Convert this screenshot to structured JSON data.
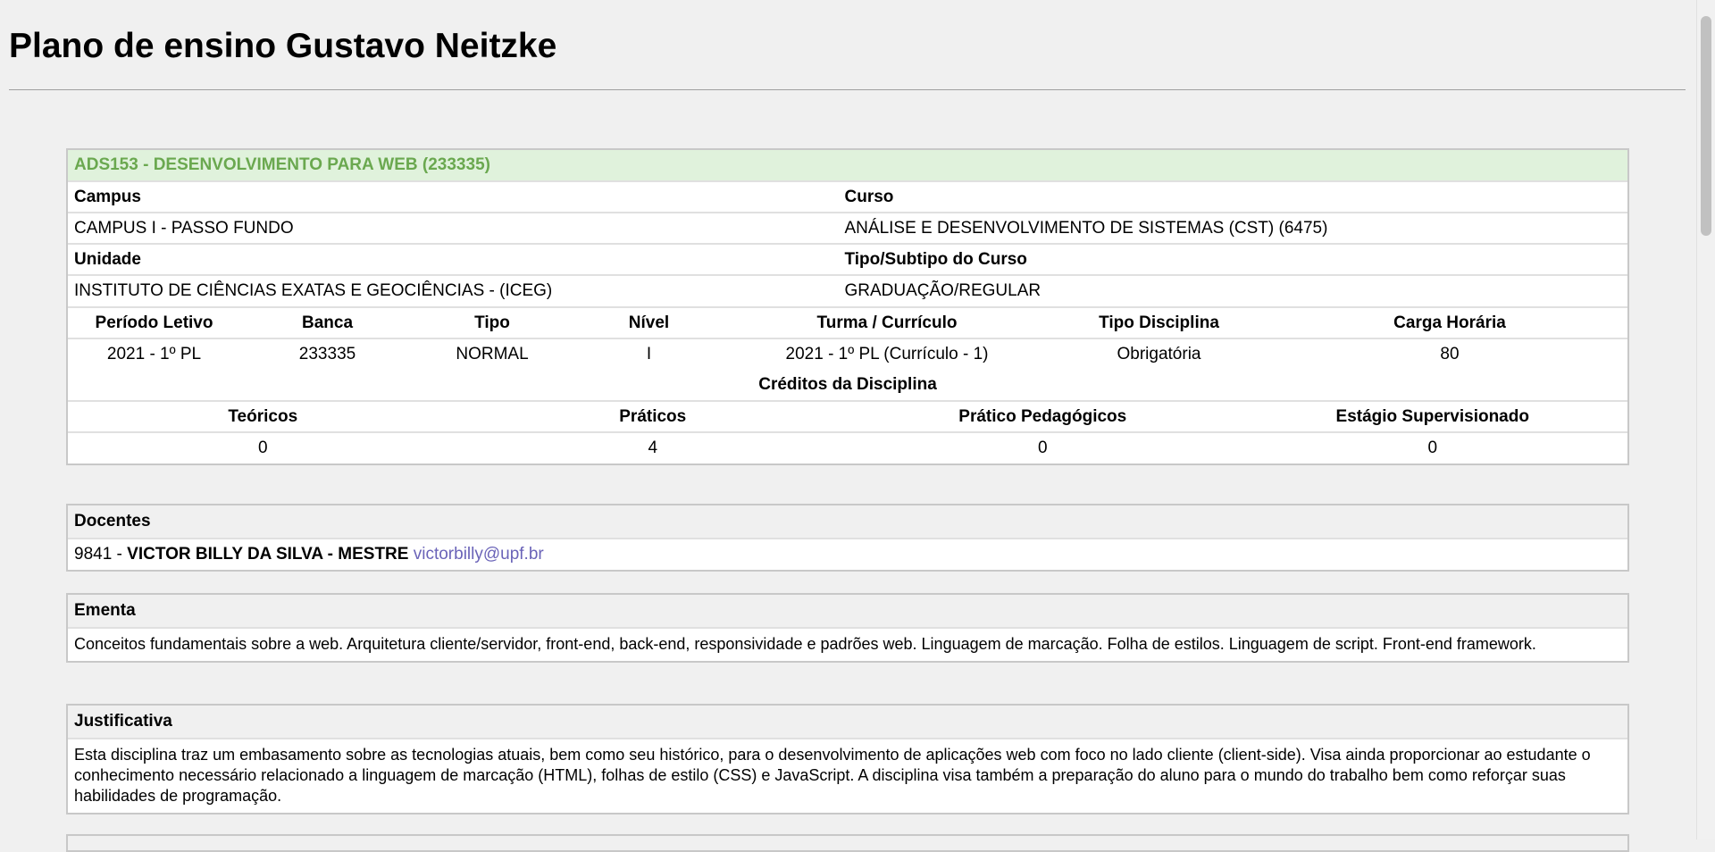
{
  "page": {
    "title": "Plano de ensino Gustavo Neitzke"
  },
  "discipline": {
    "heading": "ADS153 - DESENVOLVIMENTO PARA WEB (233335)",
    "campus_label": "Campus",
    "campus_value": "CAMPUS I - PASSO FUNDO",
    "curso_label": "Curso",
    "curso_value": "ANÁLISE E DESENVOLVIMENTO DE SISTEMAS (CST) (6475)",
    "unidade_label": "Unidade",
    "unidade_value": "INSTITUTO DE CIÊNCIAS EXATAS E GEOCIÊNCIAS - (ICEG)",
    "tipo_curso_label": "Tipo/Subtipo do Curso",
    "tipo_curso_value": "GRADUAÇÃO/REGULAR",
    "info_headers": [
      "Período Letivo",
      "Banca",
      "Tipo",
      "Nível",
      "Turma / Currículo",
      "Tipo Disciplina",
      "Carga Horária"
    ],
    "info_values": [
      "2021 - 1º PL",
      "233335",
      "NORMAL",
      "I",
      "2021 - 1º PL (Currículo - 1)",
      "Obrigatória",
      "80"
    ],
    "credits_title": "Créditos da Disciplina",
    "credits_headers": [
      "Teóricos",
      "Práticos",
      "Prático Pedagógicos",
      "Estágio Supervisionado"
    ],
    "credits_values": [
      "0",
      "4",
      "0",
      "0"
    ]
  },
  "docentes": {
    "heading": "Docentes",
    "code": "9841 -",
    "name": "VICTOR BILLY DA SILVA - MESTRE",
    "email": "victorbilly@upf.br"
  },
  "ementa": {
    "heading": "Ementa",
    "text": "Conceitos fundamentais sobre a web. Arquitetura cliente/servidor, front-end, back-end, responsividade e padrões web. Linguagem de marcação. Folha de estilos. Linguagem de script. Front-end framework."
  },
  "justificativa": {
    "heading": "Justificativa",
    "text": "Esta disciplina traz um embasamento sobre as tecnologias atuais, bem como seu histórico, para o desenvolvimento de aplicações web com foco no lado cliente (client-side). Visa ainda proporcionar ao estudante o conhecimento necessário relacionado a linguagem de marcação (HTML), folhas de estilo (CSS) e JavaScript. A disciplina visa também a preparação do aluno para o mundo do trabalho bem como reforçar suas habilidades de programação."
  }
}
